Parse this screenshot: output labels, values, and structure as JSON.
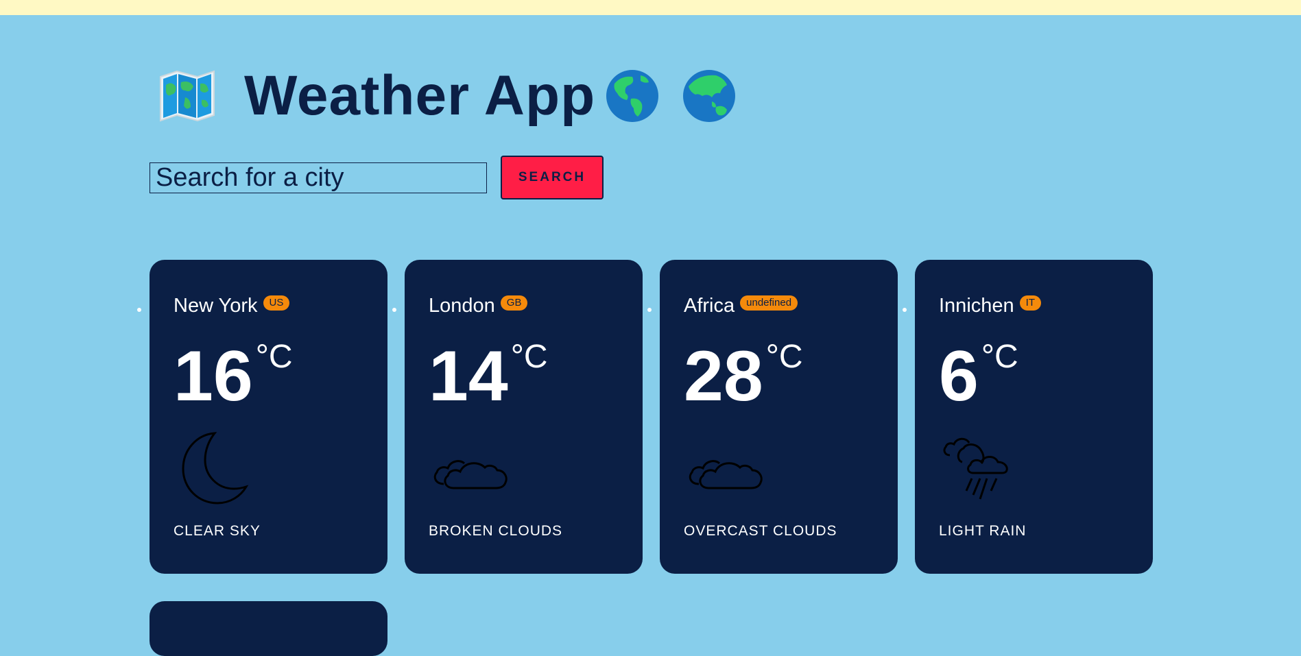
{
  "header": {
    "title": "Weather App",
    "icons": [
      "map-icon",
      "globe-americas-icon",
      "globe-asia-australia-icon"
    ]
  },
  "search": {
    "placeholder": "Search for a city",
    "button_label": "SEARCH"
  },
  "cities": [
    {
      "name": "New York",
      "country": "US",
      "temp": "16",
      "unit": "°C",
      "icon": "moon-icon",
      "description": "CLEAR SKY"
    },
    {
      "name": "London",
      "country": "GB",
      "temp": "14",
      "unit": "°C",
      "icon": "clouds-icon",
      "description": "BROKEN CLOUDS"
    },
    {
      "name": "Africa",
      "country": "undefined",
      "temp": "28",
      "unit": "°C",
      "icon": "clouds-icon",
      "description": "OVERCAST CLOUDS"
    },
    {
      "name": "Innichen",
      "country": "IT",
      "temp": "6",
      "unit": "°C",
      "icon": "rain-icon",
      "description": "LIGHT RAIN"
    }
  ],
  "colors": {
    "background": "#87ceeb",
    "top_strip": "#fff9c4",
    "card": "#0b1f45",
    "badge": "#f58a0b",
    "button": "#ff1e46"
  }
}
